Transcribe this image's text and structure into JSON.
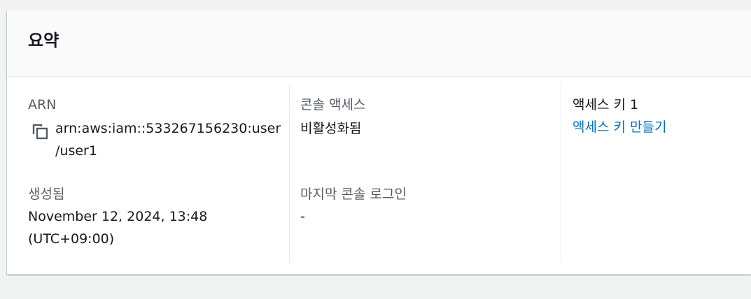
{
  "summary": {
    "title": "요약"
  },
  "arn": {
    "label": "ARN",
    "value_line1": "arn:aws:iam::533267156230:user",
    "value_line2": "/user1",
    "copy_icon": "copy-icon"
  },
  "created": {
    "label": "생성됨",
    "value_line1": "November 12, 2024, 13:48",
    "value_line2": "(UTC+09:00)"
  },
  "console_access": {
    "label": "콘솔 액세스",
    "value": "비활성화됨"
  },
  "last_console_login": {
    "label": "마지막 콘솔 로그인",
    "value": "-"
  },
  "access_key": {
    "label": "액세스 키 1",
    "link": "액세스 키 만들기"
  },
  "colors": {
    "link": "#0073bb",
    "label": "#545b64",
    "text": "#16191f",
    "background": "#f2f3f3"
  }
}
